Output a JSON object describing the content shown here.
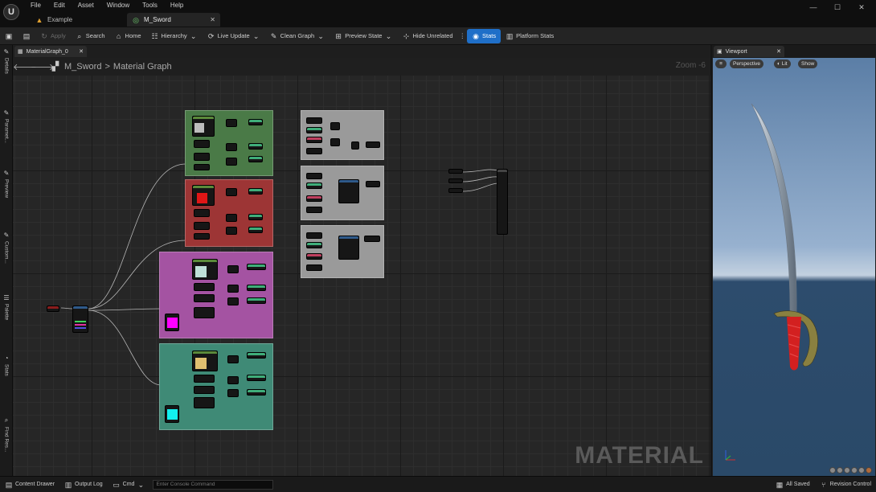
{
  "window": {
    "logo": "U",
    "menu": [
      "File",
      "Edit",
      "Asset",
      "Window",
      "Tools",
      "Help"
    ],
    "tabs": [
      {
        "label": "Example",
        "active": false
      },
      {
        "label": "M_Sword",
        "active": true
      }
    ],
    "controls": [
      "—",
      "☐",
      "✕"
    ]
  },
  "toolbar": {
    "save": "",
    "browse": "",
    "apply": "Apply",
    "search": "Search",
    "home": "Home",
    "hierarchy": "Hierarchy",
    "live_update": "Live Update",
    "clean_graph": "Clean Graph",
    "preview_state": "Preview State",
    "hide_unrelated": "Hide Unrelated",
    "stats": "Stats",
    "platform_stats": "Platform Stats"
  },
  "side_tabs": [
    "Details",
    "Paramet...",
    "Preview",
    "Custom...",
    "Palette",
    "Stats",
    "Find Res..."
  ],
  "graph": {
    "tab_label": "MaterialGraph_0",
    "breadcrumb_asset": "M_Sword",
    "breadcrumb_sep": ">",
    "breadcrumb_graph": "Material Graph",
    "zoom": "Zoom -6",
    "watermark": "MATERIAL"
  },
  "viewport": {
    "tab_label": "Viewport",
    "perspective": "Perspective",
    "lit": "Lit",
    "show": "Show"
  },
  "statusbar": {
    "content_drawer": "Content Drawer",
    "output_log": "Output Log",
    "cmd": "Cmd",
    "console_placeholder": "Enter Console Command",
    "all_saved": "All Saved",
    "revision_control": "Revision Control"
  },
  "colors": {
    "accent": "#1f6fc8",
    "comment_green": "#4a7a47",
    "comment_red": "#9d3535",
    "comment_pink": "#a453a2",
    "comment_teal": "#3f8a76",
    "comment_gray": "#9a9a9a"
  }
}
